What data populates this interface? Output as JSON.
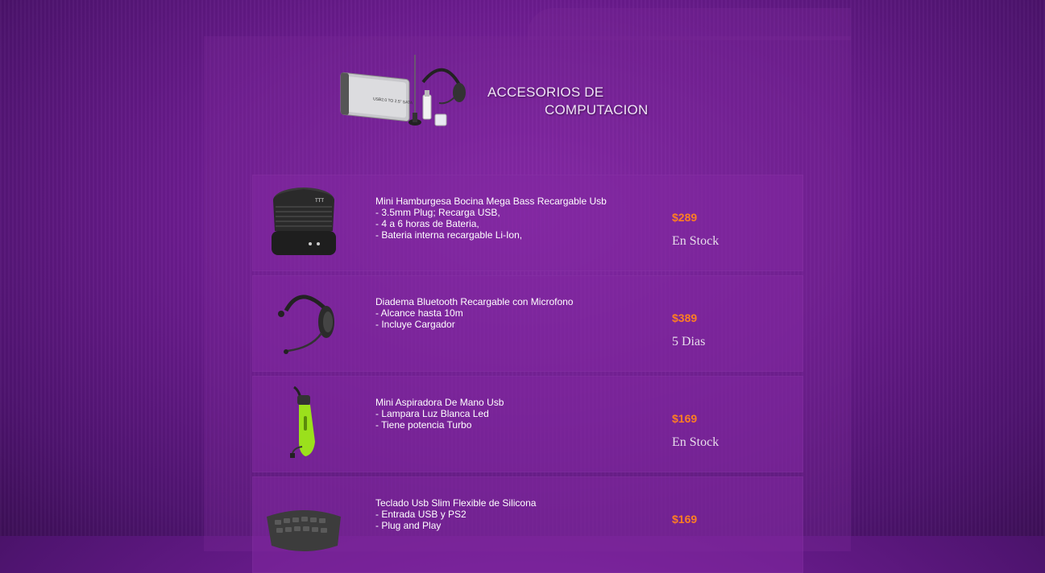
{
  "banner": {
    "title_line1": "ACCESORIOS DE",
    "title_line2": "COMPUTACION",
    "image_icon": "computer-accessories-image"
  },
  "products": [
    {
      "name": "Mini Hamburgesa Bocina Mega Bass Recargable Usb",
      "features": [
        "- 3.5mm Plug; Recarga USB,",
        "- 4 a 6 horas de Bateria,",
        "- Bateria interna recargable Li-Ion,"
      ],
      "price": "$289",
      "availability": "En Stock",
      "image_icon": "speaker-image"
    },
    {
      "name": "Diadema Bluetooth Recargable con Microfono",
      "features": [
        "- Alcance hasta 10m",
        "- Incluye Cargador"
      ],
      "price": "$389",
      "availability": "5 Dias",
      "image_icon": "headset-image"
    },
    {
      "name": "Mini Aspiradora De Mano Usb",
      "features": [
        "- Lampara Luz Blanca Led",
        "- Tiene potencia Turbo"
      ],
      "price": "$169",
      "availability": "En Stock",
      "image_icon": "vacuum-image"
    },
    {
      "name": "Teclado Usb Slim Flexible de Silicona",
      "features": [
        "- Entrada USB y PS2",
        "- Plug and Play"
      ],
      "price": "$169",
      "availability": "",
      "image_icon": "keyboard-image"
    }
  ],
  "colors": {
    "price": "#ff7e22",
    "background": "#6c1c8f"
  }
}
